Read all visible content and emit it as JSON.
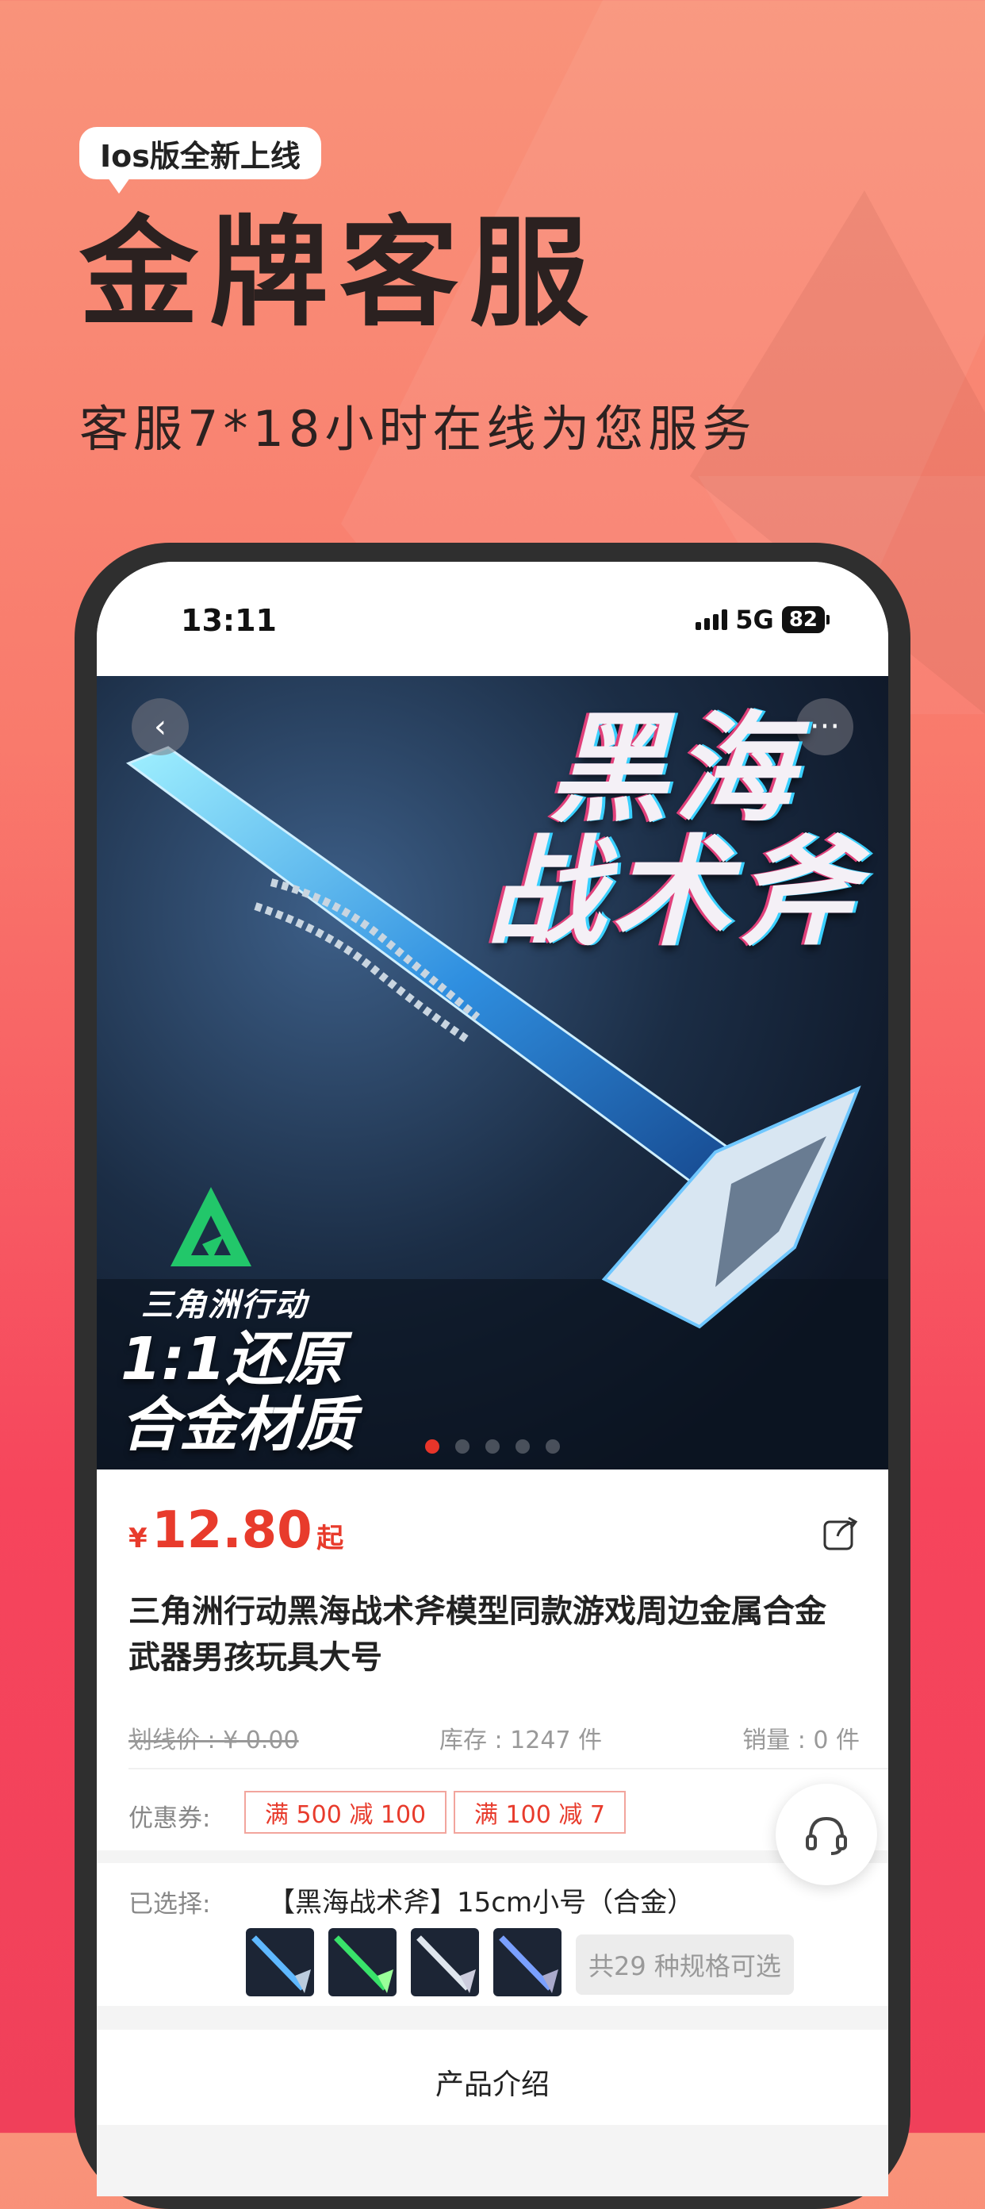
{
  "promo": {
    "badge": "Ios版全新上线",
    "headline": "金牌客服",
    "subline": "客服7*18小时在线为您服务"
  },
  "status_bar": {
    "time": "13:11",
    "network": "5G",
    "battery": "82"
  },
  "hero": {
    "title_line1": "黑海",
    "title_line2": "战术斧",
    "brand": "三角洲行动",
    "claim_line1": "1:1还原",
    "claim_line2": "合金材质",
    "slide_active_index": 0,
    "slide_count": 5
  },
  "product": {
    "currency": "¥",
    "price": "12.80",
    "price_suffix": "起",
    "title": "三角洲行动黑海战术斧模型同款游戏周边金属合金武器男孩玩具大号",
    "original_price": "划线价 : ¥ 0.00",
    "stock": "库存 : 1247 件",
    "sales": "销量 : 0 件"
  },
  "coupons": {
    "label": "优惠券:",
    "items": [
      "满 500 减 100",
      "满 100 减 7"
    ]
  },
  "selection": {
    "label": "已选择:",
    "value": "【黑海战术斧】15cm小号（合金）",
    "specs_count": "共29 种规格可选"
  },
  "intro": {
    "title": "产品介绍"
  },
  "colors": {
    "accent": "#e83b2c",
    "background_top": "#f9937a",
    "background_bottom": "#f0405a"
  }
}
